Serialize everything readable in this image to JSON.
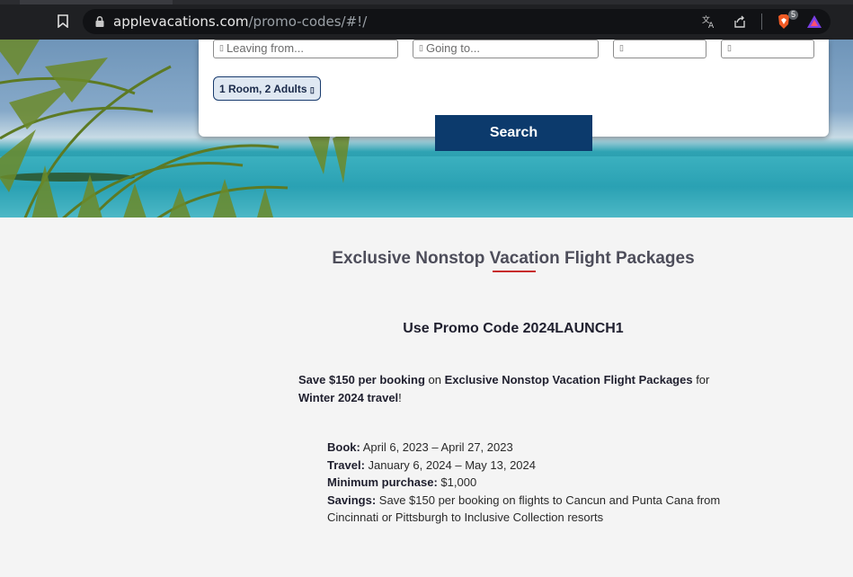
{
  "browser": {
    "url_host": "applevacations.com",
    "url_path": "/promo-codes/#!/",
    "extension_badge": "5"
  },
  "search": {
    "leaving_placeholder": "Leaving from...",
    "going_placeholder": "Going to...",
    "glyph": "▯",
    "rooms_label": "1 Room, 2 Adults",
    "search_button": "Search"
  },
  "content": {
    "heading": "Exclusive Nonstop Vacation Flight Packages",
    "promo_line": "Use Promo Code 2024LAUNCH1",
    "intro": {
      "savings_bold": "Save $150 per booking",
      "on": " on ",
      "package_bold": "Exclusive Nonstop Vacation Flight Packages",
      "for": " for ",
      "period_bold": "Winter 2024 travel",
      "end": "!"
    },
    "details": [
      {
        "label": "Book:",
        "value": " April 6, 2023 – April 27, 2023"
      },
      {
        "label": "Travel:",
        "value": " January 6, 2024 – May 13, 2024"
      },
      {
        "label": "Minimum purchase:",
        "value": " $1,000"
      },
      {
        "label": "Savings:",
        "value": " Save $150 per booking on flights to Cancun and Punta Cana from Cincinnati or Pittsburgh to Inclusive Collection resorts"
      }
    ]
  }
}
